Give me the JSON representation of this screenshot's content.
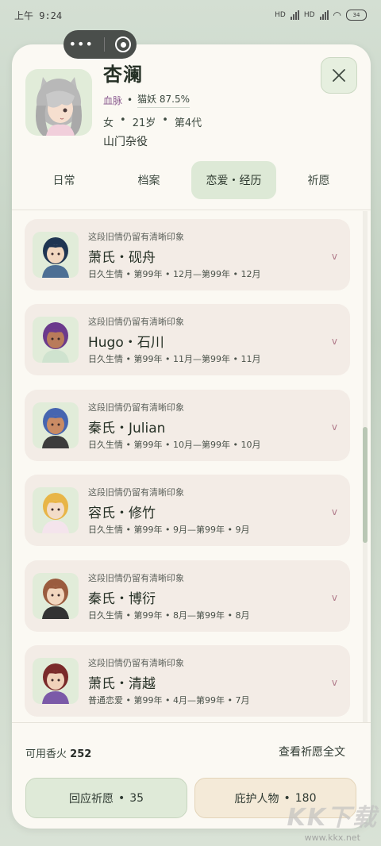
{
  "statusbar": {
    "time": "上午 9:24",
    "net1": "HD",
    "net2": "HD",
    "battery": "34"
  },
  "profile": {
    "name": "杏澜",
    "blood_label": "血脉",
    "blood_value": "猫妖 87.5%",
    "gender": "女",
    "age": "21岁",
    "generation": "第4代",
    "role": "山门杂役"
  },
  "tabs": [
    {
      "label": "日常"
    },
    {
      "label": "档案"
    },
    {
      "label": "恋爱・经历",
      "active": true
    },
    {
      "label": "祈愿"
    }
  ],
  "romances": [
    {
      "note": "这段旧情仍留有清晰印象",
      "name": "萧氏・砚舟",
      "type": "日久生情",
      "year": "第99年",
      "range": "12月—第99年",
      "end": "12月",
      "hair": "#1f3552",
      "shirt": "#4d6f94",
      "skin": "#f2d7bf"
    },
    {
      "note": "这段旧情仍留有清晰印象",
      "name": "Hugo・石川",
      "type": "日久生情",
      "year": "第99年",
      "range": "11月—第99年",
      "end": "11月",
      "hair": "#6b3a8c",
      "shirt": "#cfe3cf",
      "skin": "#b97b5a"
    },
    {
      "note": "这段旧情仍留有清晰印象",
      "name": "秦氏・Julian",
      "type": "日久生情",
      "year": "第99年",
      "range": "10月—第99年",
      "end": "10月",
      "hair": "#4665b0",
      "shirt": "#3c3c3c",
      "skin": "#c98b64"
    },
    {
      "note": "这段旧情仍留有清晰印象",
      "name": "容氏・修竹",
      "type": "日久生情",
      "year": "第99年",
      "range": "9月—第99年",
      "end": "9月",
      "hair": "#e8b547",
      "shirt": "#f4e4ec",
      "skin": "#f3dcc8"
    },
    {
      "note": "这段旧情仍留有清晰印象",
      "name": "秦氏・博衍",
      "type": "日久生情",
      "year": "第99年",
      "range": "8月—第99年",
      "end": "8月",
      "hair": "#9a5b3e",
      "shirt": "#333333",
      "skin": "#f2d6be"
    },
    {
      "note": "这段旧情仍留有清晰印象",
      "name": "萧氏・清越",
      "type": "普通恋爱",
      "year": "第99年",
      "range": "4月—第99年",
      "end": "7月",
      "hair": "#7a2a2a",
      "shirt": "#7b5aa8",
      "skin": "#f0d2ba"
    }
  ],
  "footer": {
    "incense_label": "可用香火",
    "incense_value": "252",
    "view_all": "查看祈愿全文",
    "respond_label": "回应祈愿",
    "respond_count": "35",
    "protect_label": "庇护人物",
    "protect_count": "180"
  },
  "watermark": {
    "brand": "KK下载",
    "url": "www.kkx.net"
  }
}
